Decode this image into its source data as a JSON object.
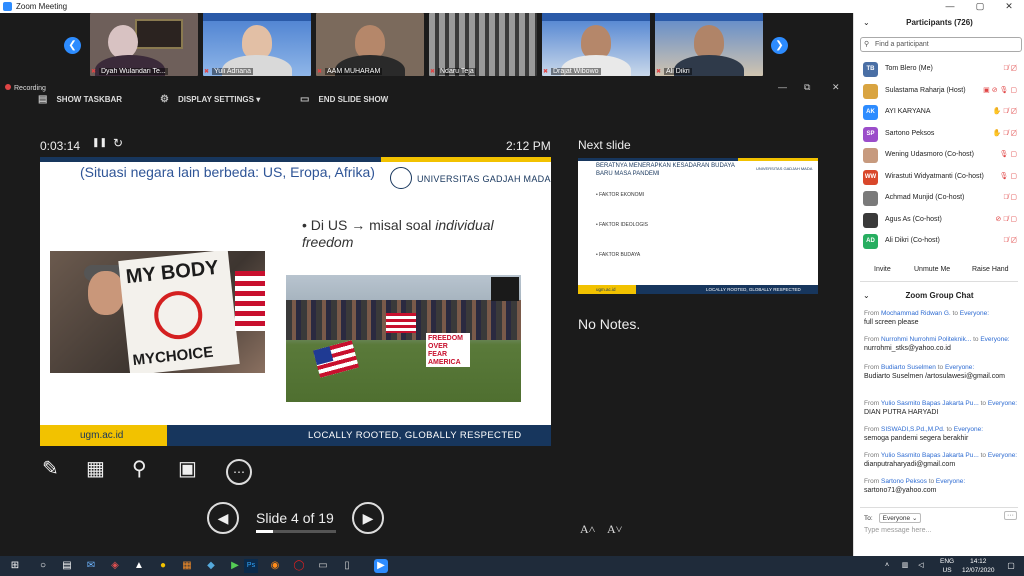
{
  "window": {
    "title": "Zoom Meeting",
    "minimize": "—",
    "maximize": "▢",
    "close": "✕"
  },
  "gallery": {
    "prev_icon": "❮",
    "next_icon": "❯",
    "tiles": [
      {
        "name": "Dyah Wulandari Te...",
        "mic": "muted"
      },
      {
        "name": "Yuli Adriana",
        "mic": "muted"
      },
      {
        "name": "AAM MUHARAM",
        "mic": "muted"
      },
      {
        "name": "Ndaru Teja",
        "mic": "muted"
      },
      {
        "name": "Drajat Wibowo",
        "mic": "muted"
      },
      {
        "name": "Ali Dikri",
        "mic": "muted"
      }
    ]
  },
  "recording": "Recording",
  "presenter_bar": {
    "show_taskbar": "SHOW TASKBAR",
    "display_settings": "DISPLAY SETTINGS ▾",
    "end_slide_show": "END SLIDE SHOW"
  },
  "presenter": {
    "timer": "0:03:14",
    "pause_icon": "❚❚",
    "reset_icon": "↻",
    "clock": "2:12 PM",
    "slide_counter": "Slide 4 of 19",
    "progress_fraction": 0.21,
    "prev_icon": "◀",
    "next_icon": "▶",
    "tool_icons": {
      "pen": "✎",
      "grid": "▦",
      "zoom": "⚲",
      "screen": "▣",
      "more": "⋯"
    },
    "next_slide_label": "Next slide",
    "no_notes": "No Notes.",
    "font_up": "A˄",
    "font_down": "A˅"
  },
  "current_slide": {
    "heading": "(Situasi negara lain berbeda: US, Eropa, Afrika)",
    "university": "UNIVERSITAS GADJAH MADA",
    "bullet_prefix": "• Di US → misal soal ",
    "bullet_italic": "individual freedom",
    "photo1_sign_top": "MY BODY",
    "photo1_sign_bottom": "MYCHOICE",
    "photo2_sign": "FREEDOM OVER FEAR AMERICA",
    "footer_left": "ugm.ac.id",
    "footer_right": "LOCALLY ROOTED, GLOBALLY RESPECTED"
  },
  "next_slide": {
    "title": "BERATNYA MENERAPKAN KESADARAN BUDAYA BARU MASA PANDEMI",
    "university": "UNIVERSITAS GADJAH MADA",
    "bullets": [
      "• FAKTOR EKONOMI",
      "• FAKTOR IDEOLOGIS",
      "• FAKTOR BUDAYA"
    ],
    "footer_left": "ugm.ac.id",
    "footer_right": "LOCALLY ROOTED, GLOBALLY RESPECTED"
  },
  "participants": {
    "title": "Participants (726)",
    "search_placeholder": "Find a participant",
    "list": [
      {
        "initials": "TB",
        "name": "Tom Blero (Me)",
        "color": "#4a6fa5",
        "icons": "🎙̸ ▢̸"
      },
      {
        "initials": "",
        "name": "Sulastama Raharja (Host)",
        "color": "#d9a441",
        "icons": "▣ ⊘ 🎙 ▢"
      },
      {
        "initials": "AK",
        "name": "AYI KARYANA",
        "color": "#2d8cff",
        "icons": "✋ 🎙̸ ▢̸"
      },
      {
        "initials": "SP",
        "name": "Sartono Peksos",
        "color": "#9b4dca",
        "icons": "✋ 🎙̸ ▢̸"
      },
      {
        "initials": "",
        "name": "Wening Udasmoro (Co-host)",
        "color": "#c79a7e",
        "icons": "🎙 ▢"
      },
      {
        "initials": "WW",
        "name": "Wirastuti Widyatmanti (Co-host)",
        "color": "#d9472b",
        "icons": "🎙 ▢"
      },
      {
        "initials": "",
        "name": "Achmad Munjid (Co-host)",
        "color": "#7a7a7a",
        "icons": "🎙̸ ▢"
      },
      {
        "initials": "",
        "name": "Agus As (Co-host)",
        "color": "#3a3a3a",
        "icons": "⊘ 🎙̸ ▢"
      },
      {
        "initials": "AD",
        "name": "Ali Dikri (Co-host)",
        "color": "#27ae60",
        "icons": "🎙̸ ▢̸"
      }
    ],
    "invite": "Invite",
    "unmute_me": "Unmute Me",
    "raise_hand": "Raise Hand"
  },
  "chat": {
    "title": "Zoom Group Chat",
    "from_label": "From",
    "to_label": "to",
    "messages": [
      {
        "from": "Mochammad Ridwan G.",
        "to": "Everyone:",
        "text": "full screen please"
      },
      {
        "from": "Nurrohmi Nurrohmi Politeknik...",
        "to": "Everyone:",
        "text": "nurrohmi_stks@yahoo.co.id"
      },
      {
        "from": "Budiarto Suselmen",
        "to": "Everyone:",
        "text": "Budiarto Suselmen /artosulawesi@gmail.com"
      },
      {
        "from": "Yulio Sasmito Bapas Jakarta Pu...",
        "to": "Everyone:",
        "text": "DIAN PUTRA HARYADI"
      },
      {
        "from": "SISWADI,S.Pd.,M.Pd.",
        "to": "Everyone:",
        "text": "semoga pandemi segera berakhir"
      },
      {
        "from": "Yulio Sasmito Bapas Jakarta Pu...",
        "to": "Everyone:",
        "text": "dianputraharyadi@gmail.com"
      },
      {
        "from": "Sartono Peksos",
        "to": "Everyone:",
        "text": "sartono71@yahoo.com"
      }
    ],
    "to": "To:",
    "to_value": "Everyone ⌄",
    "input_placeholder": "Type message here...",
    "more": "···"
  },
  "taskbar": {
    "lang": "ENG",
    "region": "US",
    "time": "14:12",
    "date": "12/07/2020"
  }
}
